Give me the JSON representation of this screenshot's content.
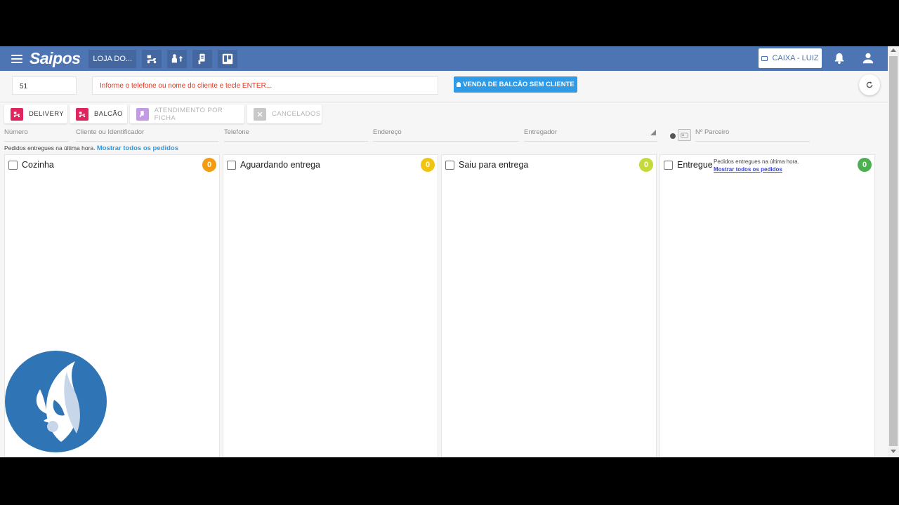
{
  "header": {
    "logo": "Saipos",
    "store_label": "LOJA DO...",
    "caixa_label": "CAIXA - LUIZ",
    "icons": [
      "menu-icon",
      "delivery-scooter-icon",
      "transfer-icon",
      "ticket-hand-icon",
      "board-icon",
      "bell-icon",
      "user-icon"
    ]
  },
  "search": {
    "order_number_value": "51",
    "client_placeholder": "Informe o telefone ou nome do cliente e tecle ENTER...",
    "venda_button": "VENDA DE BALCÃO SEM CLIENTE"
  },
  "filters": [
    {
      "label": "DELIVERY",
      "color": "#e0245e",
      "enabled": true
    },
    {
      "label": "BALCÃO",
      "color": "#e0245e",
      "enabled": true
    },
    {
      "label": "ATENDIMENTO POR FICHA",
      "color": "#c39ae6",
      "enabled": false
    },
    {
      "label": "CANCELADOS",
      "color": "#c8c8c8",
      "enabled": false
    }
  ],
  "column_filters": {
    "numero": "Número",
    "cliente": "Cliente ou Identificador",
    "telefone": "Telefone",
    "endereco": "Endereço",
    "entregador": "Entregador",
    "parceiro": "Nº Parceiro"
  },
  "notice": {
    "text": "Pedidos entregues na última hora.",
    "link": "Mostrar todos os pedidos"
  },
  "columns": [
    {
      "title": "Cozinha",
      "count": "0",
      "badge_color": "#f39c12"
    },
    {
      "title": "Aguardando entrega",
      "count": "0",
      "badge_color": "#f1c40f"
    },
    {
      "title": "Saiu para entrega",
      "count": "0",
      "badge_color": "#c6d93a"
    },
    {
      "title": "Entregue",
      "count": "0",
      "badge_color": "#4caf50",
      "note": "Pedidos entregues na última hora.",
      "note_link": "Mostrar todos os pedidos"
    }
  ],
  "colors": {
    "header": "#4d74b3",
    "accent": "#2f9be6"
  }
}
